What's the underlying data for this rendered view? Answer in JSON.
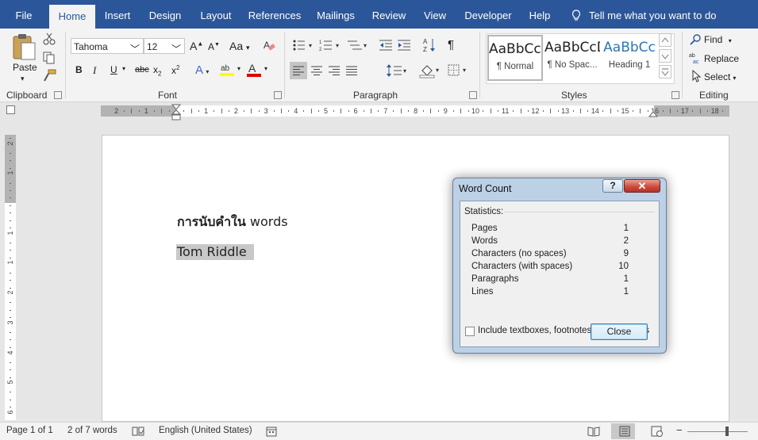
{
  "tabs": [
    "File",
    "Home",
    "Insert",
    "Design",
    "Layout",
    "References",
    "Mailings",
    "Review",
    "View",
    "Developer",
    "Help"
  ],
  "active_tab": "Home",
  "tell_me": "Tell me what you want to do",
  "clipboard": {
    "paste": "Paste",
    "group": "Clipboard"
  },
  "font": {
    "name": "Tahoma",
    "size": "12",
    "group": "Font",
    "grow": "A",
    "shrink": "A",
    "case": "Aa",
    "bold": "B",
    "italic": "I",
    "underline": "U",
    "strike": "abc",
    "sub": "x",
    "sup": "x"
  },
  "paragraph": {
    "group": "Paragraph"
  },
  "styles": {
    "group": "Styles",
    "items": [
      {
        "preview": "AaBbCcD",
        "name": "¶ Normal"
      },
      {
        "preview": "AaBbCcD",
        "name": "¶ No Spac..."
      },
      {
        "preview": "AaBbCc",
        "name": "Heading 1"
      }
    ]
  },
  "editing": {
    "find": "Find",
    "replace": "Replace",
    "select": "Select",
    "group": "Editing"
  },
  "ruler": {
    "h_numbers": [
      "2",
      "1",
      "1",
      "2",
      "3",
      "4",
      "5",
      "6",
      "7",
      "8",
      "9",
      "10",
      "11",
      "12",
      "13",
      "14",
      "15",
      "16",
      "17",
      "18"
    ],
    "v_numbers": [
      "2",
      "1",
      "1",
      "1",
      "2",
      "3",
      "4",
      "5",
      "6",
      "7"
    ]
  },
  "document": {
    "line1_thai": "การนับคำใน",
    "line1_en": "words",
    "line2": "Tom Riddle"
  },
  "dialog": {
    "title": "Word Count",
    "help": "?",
    "stats_label": "Statistics:",
    "rows": [
      {
        "label": "Pages",
        "value": "1"
      },
      {
        "label": "Words",
        "value": "2"
      },
      {
        "label": "Characters (no spaces)",
        "value": "9"
      },
      {
        "label": "Characters (with spaces)",
        "value": "10"
      },
      {
        "label": "Paragraphs",
        "value": "1"
      },
      {
        "label": "Lines",
        "value": "1"
      }
    ],
    "checkbox_label": "Include textboxes, footnotes and endnotes",
    "close": "Close"
  },
  "status": {
    "page": "Page 1 of 1",
    "words": "2 of 7 words",
    "language": "English (United States)"
  },
  "colors": {
    "accent": "#2b579a",
    "highlight": "#ffff00",
    "font_color": "#e00000"
  }
}
